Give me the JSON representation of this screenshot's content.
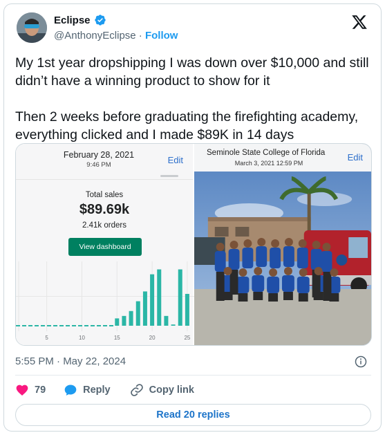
{
  "author": {
    "name": "Eclipse",
    "handle": "@AnthonyEclipse",
    "separator": "·",
    "follow_label": "Follow"
  },
  "icons": {
    "verified": "verified-badge-icon",
    "platform": "x-logo-icon",
    "info": "info-icon",
    "like": "heart-icon",
    "reply": "speech-bubble-icon",
    "copy_link": "link-icon"
  },
  "colors": {
    "accent": "#1d9bf0",
    "like": "#f91880",
    "shopify_green": "#008060",
    "bars": "#2bb6a6"
  },
  "tweet": {
    "paragraph_1": "My 1st year dropshipping I was down over $10,000 and still didn’t have a winning product to show for it",
    "paragraph_2": "Then 2 weeks before graduating the firefighting academy, everything clicked and I made $89K in 14 days",
    "timestamp": "5:55 PM · May 22, 2024"
  },
  "media": {
    "left": {
      "date": "February 28, 2021",
      "time": "9:46 PM",
      "edit_label": "Edit",
      "total_label": "Total sales",
      "total_value": "$89.69k",
      "orders": "2.41k orders",
      "button_label": "View dashboard"
    },
    "right": {
      "title": "Seminole State College of Florida",
      "date": "March 3, 2021  12:59 PM",
      "edit_label": "Edit"
    }
  },
  "chart_data": {
    "type": "bar",
    "x_ticks": [
      "5",
      "10",
      "15",
      "20",
      "25"
    ],
    "x": [
      15,
      16,
      17,
      18,
      19,
      20,
      21,
      22,
      23,
      24,
      25
    ],
    "values": [
      0.3,
      0.4,
      0.6,
      1.0,
      1.4,
      2.1,
      2.3,
      0.4,
      0.05,
      2.3,
      1.3
    ],
    "baseline": "dashed",
    "grid": true
  },
  "actions": {
    "likes_count": "79",
    "reply_label": "Reply",
    "copy_link_label": "Copy link",
    "read_replies_label": "Read 20 replies"
  }
}
